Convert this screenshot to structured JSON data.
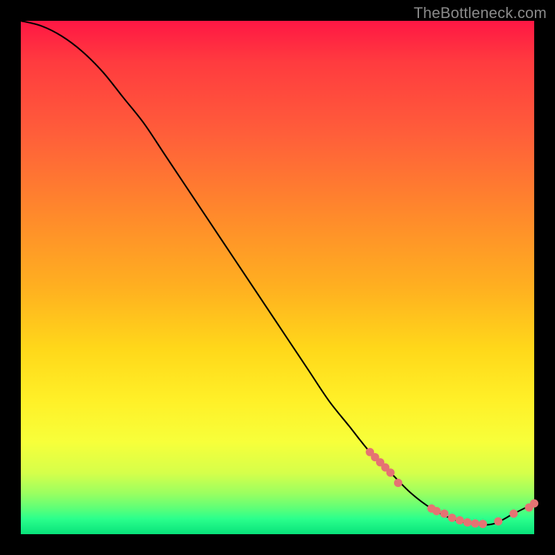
{
  "watermark": "TheBottleneck.com",
  "chart_data": {
    "type": "line",
    "title": "",
    "xlabel": "",
    "ylabel": "",
    "xlim": [
      0,
      100
    ],
    "ylim": [
      0,
      100
    ],
    "grid": false,
    "legend": false,
    "series": [
      {
        "name": "bottleneck-curve",
        "x": [
          0,
          4,
          8,
          12,
          16,
          20,
          24,
          28,
          32,
          36,
          40,
          44,
          48,
          52,
          56,
          60,
          64,
          68,
          72,
          76,
          80,
          84,
          88,
          92,
          96,
          100
        ],
        "y": [
          100,
          99,
          97,
          94,
          90,
          85,
          80,
          74,
          68,
          62,
          56,
          50,
          44,
          38,
          32,
          26,
          21,
          16,
          12,
          8,
          5,
          3,
          2,
          2,
          4,
          6
        ]
      }
    ],
    "markers": [
      {
        "x": 68,
        "y": 16
      },
      {
        "x": 69,
        "y": 15
      },
      {
        "x": 70,
        "y": 14
      },
      {
        "x": 71,
        "y": 13
      },
      {
        "x": 72,
        "y": 12
      },
      {
        "x": 73.5,
        "y": 10
      },
      {
        "x": 80,
        "y": 5
      },
      {
        "x": 81,
        "y": 4.5
      },
      {
        "x": 82.5,
        "y": 4
      },
      {
        "x": 84,
        "y": 3.2
      },
      {
        "x": 85.5,
        "y": 2.7
      },
      {
        "x": 87,
        "y": 2.3
      },
      {
        "x": 88.5,
        "y": 2.1
      },
      {
        "x": 90,
        "y": 2.0
      },
      {
        "x": 93,
        "y": 2.5
      },
      {
        "x": 96,
        "y": 4.0
      },
      {
        "x": 99,
        "y": 5.2
      },
      {
        "x": 100,
        "y": 6.0
      }
    ],
    "background_gradient": {
      "top": "#ff1744",
      "mid": "#ffd81a",
      "bottom": "#08e27a"
    }
  }
}
